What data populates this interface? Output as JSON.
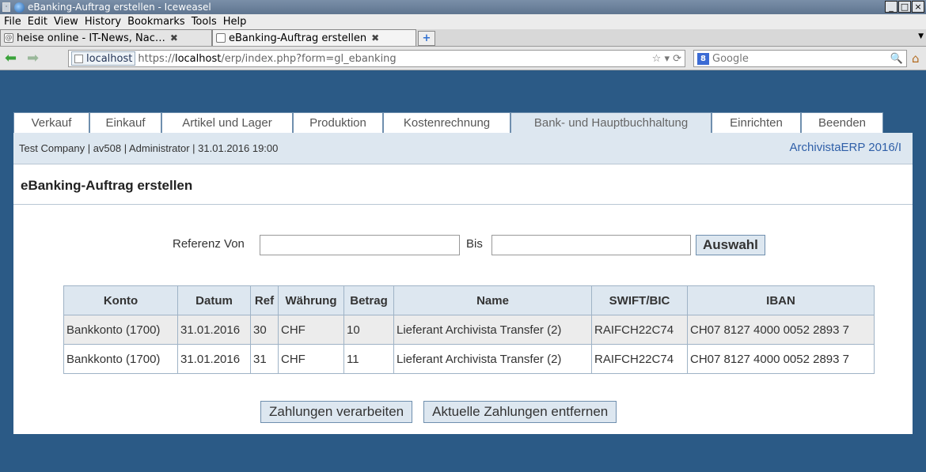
{
  "window": {
    "title": "eBanking-Auftrag erstellen - Iceweasel"
  },
  "menu": [
    "File",
    "Edit",
    "View",
    "History",
    "Bookmarks",
    "Tools",
    "Help"
  ],
  "browser_tabs": [
    {
      "label": "heise online - IT-News, Nac…",
      "active": false
    },
    {
      "label": "eBanking-Auftrag erstellen",
      "active": true
    }
  ],
  "address": {
    "site": "localhost",
    "url_prefix": "https://",
    "url_host": "localhost",
    "url_path": "/erp/index.php?form=gl_ebanking"
  },
  "search": {
    "engine_letter": "8",
    "placeholder": "Google"
  },
  "app_tabs": [
    {
      "label": "Verkauf",
      "active": false
    },
    {
      "label": "Einkauf",
      "active": false
    },
    {
      "label": "Artikel und Lager",
      "active": false
    },
    {
      "label": "Produktion",
      "active": false
    },
    {
      "label": "Kostenrechnung",
      "active": false
    },
    {
      "label": "Bank- und Hauptbuchhaltung",
      "active": true
    },
    {
      "label": "Einrichten",
      "active": false
    },
    {
      "label": "Beenden",
      "active": false
    }
  ],
  "info": {
    "session": "Test Company | av508 | Administrator | 31.01.2016 19:00",
    "product": "ArchivistaERP 2016/I"
  },
  "page": {
    "title": "eBanking-Auftrag erstellen"
  },
  "filter": {
    "from_label": "Referenz Von",
    "from_value": "",
    "to_label": "Bis",
    "to_value": "",
    "select_button": "Auswahl"
  },
  "table": {
    "headers": [
      "Konto",
      "Datum",
      "Ref",
      "Währung",
      "Betrag",
      "Name",
      "SWIFT/BIC",
      "IBAN"
    ],
    "rows": [
      [
        "Bankkonto (1700)",
        "31.01.2016",
        "30",
        "CHF",
        "10",
        "Lieferant Archivista Transfer (2)",
        "RAIFCH22C74",
        "CH07 8127 4000 0052 2893 7"
      ],
      [
        "Bankkonto (1700)",
        "31.01.2016",
        "31",
        "CHF",
        "11",
        "Lieferant Archivista Transfer (2)",
        "RAIFCH22C74",
        "CH07 8127 4000 0052 2893 7"
      ]
    ]
  },
  "actions": {
    "process": "Zahlungen verarbeiten",
    "remove": "Aktuelle Zahlungen entfernen"
  }
}
